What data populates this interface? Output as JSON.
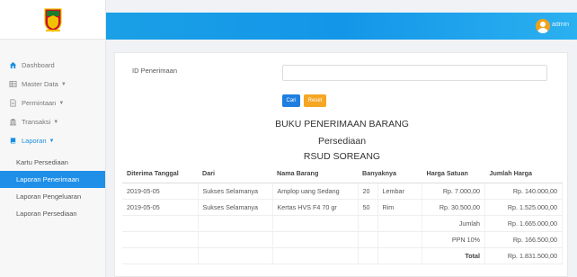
{
  "sidebar": {
    "items": [
      {
        "label": "Dashboard",
        "icon": "home-icon",
        "caret": false
      },
      {
        "label": "Master Data",
        "icon": "table-icon",
        "caret": true
      },
      {
        "label": "Permintaan",
        "icon": "document-icon",
        "caret": true
      },
      {
        "label": "Transaksi",
        "icon": "bank-icon",
        "caret": true
      },
      {
        "label": "Laporan",
        "icon": "book-icon",
        "caret": true
      }
    ],
    "subitems": [
      {
        "label": "Kartu Persediaan"
      },
      {
        "label": "Laporan Penerimaan"
      },
      {
        "label": "Laporan Pengeluaran"
      },
      {
        "label": "Laporan Persediaan"
      }
    ]
  },
  "topbar": {
    "user_name": "admin"
  },
  "form": {
    "id_label": "ID Penerimaan",
    "id_value": "",
    "cari_label": "Cari",
    "reset_label": "Reset"
  },
  "report": {
    "title1": "BUKU PENERIMAAN BARANG",
    "title2": "Persediaan",
    "title3": "RSUD SOREANG"
  },
  "table": {
    "headers": [
      "Diterima Tanggal",
      "Dari",
      "Nama Barang",
      "Banyaknya",
      "Harga Satuan",
      "Jumlah Harga"
    ],
    "rows": [
      {
        "tanggal": "2019-05-05",
        "dari": "Sukses Selamanya",
        "barang": "Amplop uang Sedang",
        "qty": "20",
        "unit": "Lembar",
        "harga": "Rp. 7.000,00",
        "jumlah": "Rp. 140.000,00"
      },
      {
        "tanggal": "2019-05-05",
        "dari": "Sukses Selamanya",
        "barang": "Kertas HVS F4 70 gr",
        "qty": "50",
        "unit": "Rim",
        "harga": "Rp. 30.500,00",
        "jumlah": "Rp. 1.525.000,00"
      }
    ],
    "summary": [
      {
        "label": "Jumlah",
        "value": "Rp. 1.665.000,00"
      },
      {
        "label": "PPN 10%",
        "value": "Rp. 166.500,00"
      },
      {
        "label": "Total",
        "value": "Rp. 1.831.500,00"
      }
    ]
  },
  "colors": {
    "accent": "#1f8fe8",
    "topbar": "#1aa0e6",
    "reset": "#f5a623"
  }
}
